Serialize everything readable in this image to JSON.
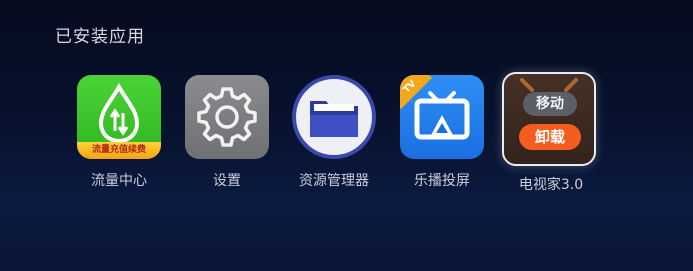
{
  "section": {
    "title": "已安装应用"
  },
  "apps": [
    {
      "label": "流量中心",
      "badge": "流量充值续费",
      "icon": "water-drop-data-icon",
      "color": "#2fb51f"
    },
    {
      "label": "设置",
      "icon": "gear-icon",
      "color": "#7a7c7f"
    },
    {
      "label": "资源管理器",
      "icon": "folder-icon",
      "color": "#3b48b0"
    },
    {
      "label": "乐播投屏",
      "icon": "tv-cast-icon",
      "corner": "TV",
      "color": "#1a6fe0"
    },
    {
      "label": "电视家3.0",
      "icon": "tv-home-icon",
      "focused": true
    }
  ],
  "context_menu": {
    "move_label": "移动",
    "uninstall_label": "卸载",
    "uninstall_color": "#f45d1e"
  }
}
